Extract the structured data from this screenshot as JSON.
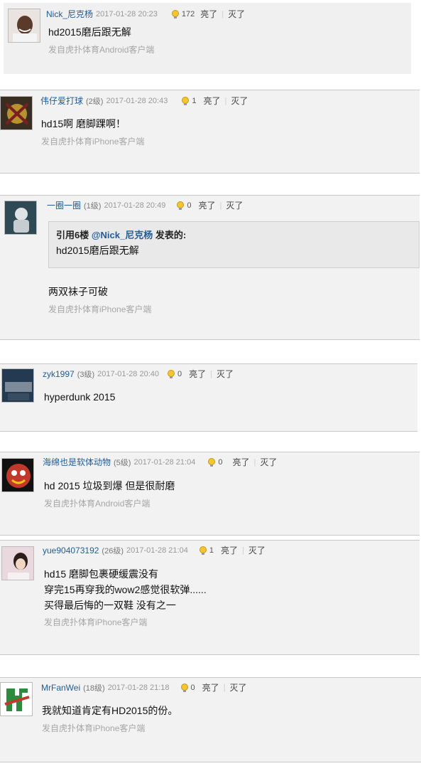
{
  "posts": [
    {
      "username": "Nick_尼克杨",
      "level": "",
      "time": "2017-01-28 20:23",
      "light_count": "172",
      "light_label": "亮了",
      "dim_label": "灭了",
      "content": "hd2015磨后跟无解",
      "client": "发自虎扑体育Android客户端"
    },
    {
      "username": "伟仔爱打球",
      "level": "(2级)",
      "time": "2017-01-28 20:43",
      "light_count": "1",
      "light_label": "亮了",
      "dim_label": "灭了",
      "content": "hd15啊 磨脚踝啊！",
      "client": "发自虎扑体育iPhone客户端"
    },
    {
      "username": "一圈一圈",
      "level": "(1级)",
      "time": "2017-01-28 20:49",
      "light_count": "0",
      "light_label": "亮了",
      "dim_label": "灭了",
      "quote": {
        "prefix": "引用6楼 ",
        "user": "@Nick_尼克杨",
        "suffix": " 发表的:",
        "text": "hd2015磨后跟无解"
      },
      "content": "两双袜子可破",
      "client": "发自虎扑体育iPhone客户端"
    },
    {
      "username": "zyk1997",
      "level": "(3级)",
      "time": "2017-01-28 20:40",
      "light_count": "0",
      "light_label": "亮了",
      "dim_label": "灭了",
      "content": "hyperdunk 2015"
    },
    {
      "username": "海绵也是软体动物",
      "level": "(5级)",
      "time": "2017-01-28 21:04",
      "light_count": "0",
      "light_label": "亮了",
      "dim_label": "灭了",
      "content": "hd 2015 垃圾到爆 但是很耐磨",
      "client": "发自虎扑体育Android客户端"
    },
    {
      "username": "yue904073192",
      "level": "(26级)",
      "time": "2017-01-28 21:04",
      "light_count": "1",
      "light_label": "亮了",
      "dim_label": "灭了",
      "lines": [
        "hd15 磨脚包裹硬缓震没有",
        "穿完15再穿我的wow2感觉很软弹......",
        "买得最后悔的一双鞋 没有之一"
      ],
      "client": "发自虎扑体育iPhone客户端"
    },
    {
      "username": "MrFanWei",
      "level": "(18级)",
      "time": "2017-01-28 21:18",
      "light_count": "0",
      "light_label": "亮了",
      "dim_label": "灭了",
      "content": "我就知道肯定有HD2015的份。",
      "client": "发自虎扑体育iPhone客户端"
    }
  ],
  "colors": {
    "username": "#1f5c99",
    "card_bg": "#f2f2f2",
    "client_text": "#a6a6a6"
  },
  "icons": {
    "light": "lightbulb-icon"
  }
}
